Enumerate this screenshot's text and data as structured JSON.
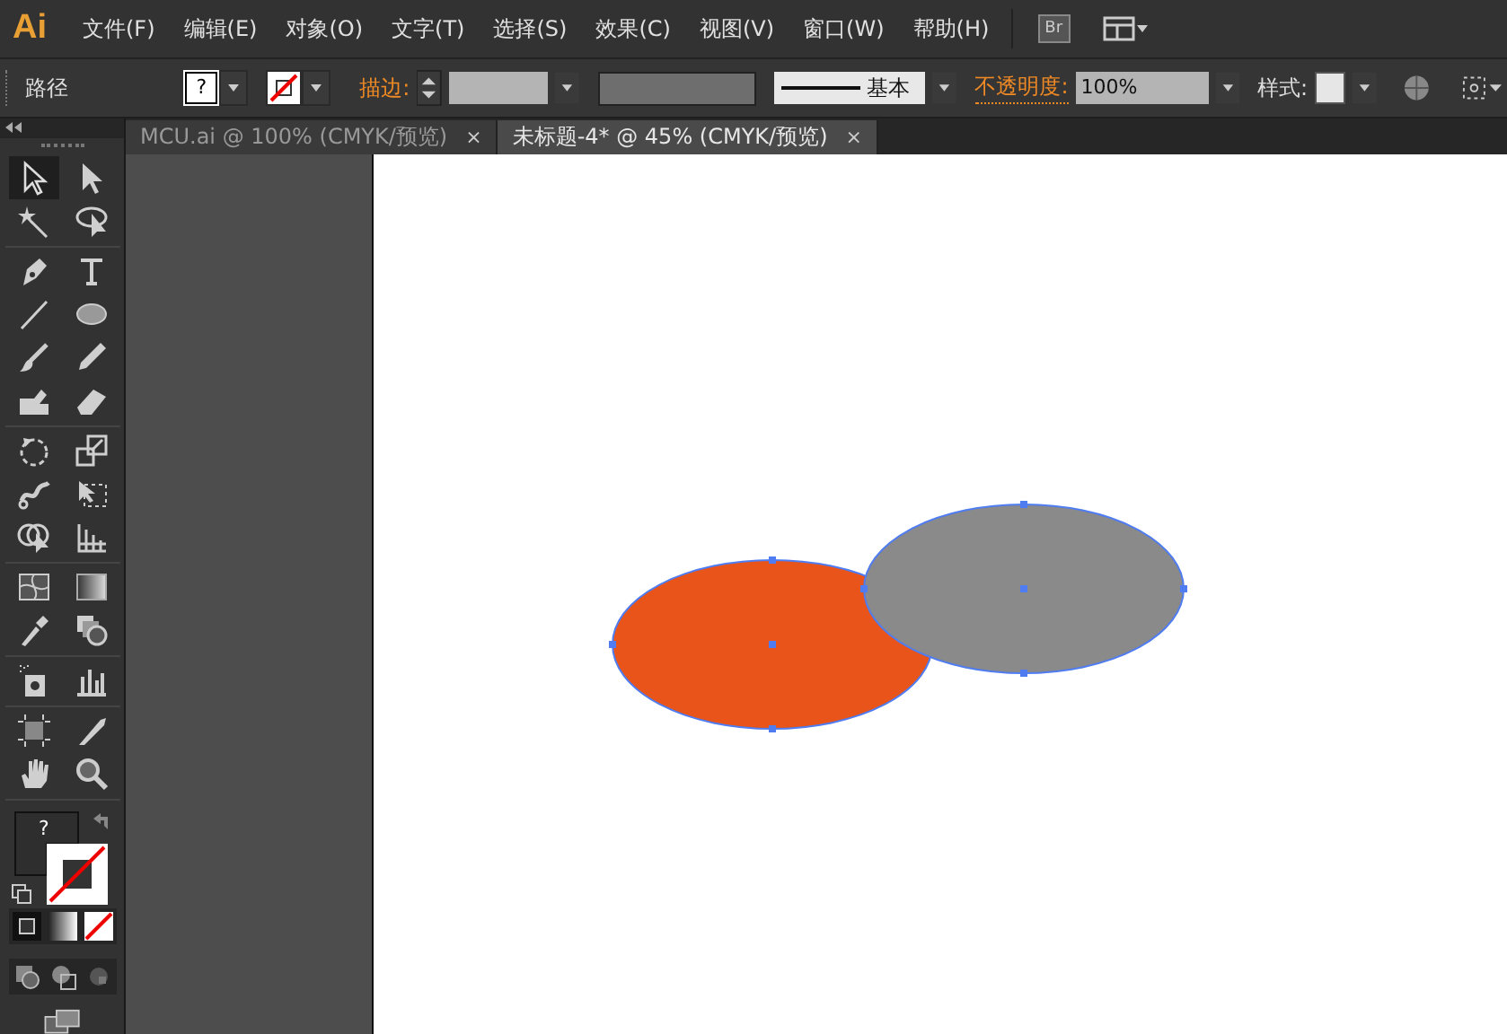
{
  "app": {
    "logo": "Ai"
  },
  "menu": [
    "文件(F)",
    "编辑(E)",
    "对象(O)",
    "文字(T)",
    "选择(S)",
    "效果(C)",
    "视图(V)",
    "窗口(W)",
    "帮助(H)"
  ],
  "app_bar": {
    "bridge_label": "Br"
  },
  "control_bar": {
    "selection_label": "路径",
    "fill_swatch": "?",
    "stroke_label": "描边:",
    "profile_label": "基本",
    "opacity_label": "不透明度:",
    "opacity_value": "100%",
    "style_label": "样式:"
  },
  "tabs": [
    {
      "label": "MCU.ai @ 100% (CMYK/预览)",
      "close": "×",
      "selected": false
    },
    {
      "label": "未标题-4* @ 45% (CMYK/预览)",
      "close": "×",
      "selected": true
    }
  ],
  "tool_groups": [
    {
      "tools": [
        {
          "kind": "selection",
          "selected": true
        },
        {
          "kind": "direct-selection",
          "selected": false
        },
        {
          "kind": "magic-wand",
          "selected": false
        },
        {
          "kind": "lasso",
          "selected": false
        }
      ]
    },
    {
      "tools": [
        {
          "kind": "pen",
          "selected": false
        },
        {
          "kind": "type",
          "selected": false
        },
        {
          "kind": "line",
          "selected": false
        },
        {
          "kind": "ellipse",
          "selected": false
        },
        {
          "kind": "brush",
          "selected": false
        },
        {
          "kind": "pencil",
          "selected": false
        },
        {
          "kind": "blob-brush",
          "selected": false
        },
        {
          "kind": "eraser",
          "selected": false
        }
      ]
    },
    {
      "tools": [
        {
          "kind": "rotate",
          "selected": false
        },
        {
          "kind": "scale",
          "selected": false
        },
        {
          "kind": "warp",
          "selected": false
        },
        {
          "kind": "free-transform",
          "selected": false
        },
        {
          "kind": "shape-builder",
          "selected": false
        },
        {
          "kind": "perspective",
          "selected": false
        }
      ]
    },
    {
      "tools": [
        {
          "kind": "mesh",
          "selected": false
        },
        {
          "kind": "gradient",
          "selected": false
        },
        {
          "kind": "eyedropper",
          "selected": false
        },
        {
          "kind": "blend",
          "selected": false
        }
      ]
    },
    {
      "tools": [
        {
          "kind": "sprayer",
          "selected": false
        },
        {
          "kind": "graph",
          "selected": false
        }
      ]
    },
    {
      "tools": [
        {
          "kind": "artboard",
          "selected": false
        },
        {
          "kind": "slice",
          "selected": false
        },
        {
          "kind": "hand",
          "selected": false
        },
        {
          "kind": "zoom",
          "selected": false
        }
      ]
    }
  ],
  "fill_stroke": {
    "fill_label": "?"
  },
  "shapes": [
    {
      "kind": "ellipse",
      "color": "#e8541a"
    },
    {
      "kind": "ellipse",
      "color": "#8a8a8a"
    }
  ]
}
